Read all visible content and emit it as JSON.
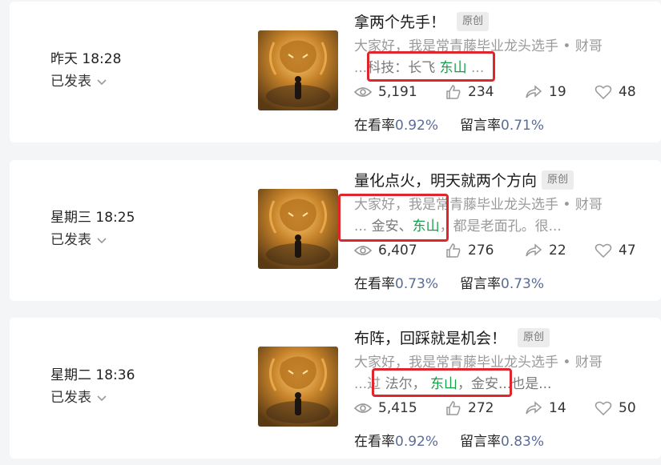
{
  "accent_colors": {
    "keyword_green": "#15a048",
    "rate_blue": "#5a6c9a",
    "highlight_red": "#e0262b"
  },
  "icons": [
    "eye-icon",
    "thumbs-up-icon",
    "share-icon",
    "heart-icon",
    "chevron-down-icon"
  ],
  "posts": [
    {
      "date": "昨天 18:28",
      "status": "已发表",
      "title": "拿两个先手！",
      "badge": "原创",
      "desc_line1": "大家好，我是常青藤毕业龙头选手 • 财哥",
      "desc_line2": {
        "pre": "...",
        "mid": "科技：长飞",
        "green": "东山",
        "post": " ..."
      },
      "views": "5,191",
      "likes": "234",
      "shares": "19",
      "favs": "48",
      "read_label": "在看率",
      "read_rate": "0.92%",
      "comment_label": "留言率",
      "comment_rate": "0.71%"
    },
    {
      "date": "星期三 18:25",
      "status": "已发表",
      "title": "量化点火，明天就两个方向",
      "badge": "原创",
      "desc_line1": "大家好，我是常青藤毕业龙头选手 • 财哥",
      "desc_line2": {
        "pre": "...",
        "mid": "金安、",
        "green": "东山",
        "post": "，都是老面孔。很..."
      },
      "views": "6,407",
      "likes": "276",
      "shares": "22",
      "favs": "47",
      "read_label": "在看率",
      "read_rate": "0.73%",
      "comment_label": "留言率",
      "comment_rate": "0.73%"
    },
    {
      "date": "星期二 18:36",
      "status": "已发表",
      "title": "布阵，回踩就是机会！",
      "badge": "原创",
      "desc_line1": "大家好，我是常青藤毕业龙头选手 • 财哥",
      "desc_line2": {
        "pre": "...过",
        "mid": "法尔，",
        "green": "东山",
        "post": "，金安...也是..."
      },
      "views": "5,415",
      "likes": "272",
      "shares": "14",
      "favs": "50",
      "read_label": "在看率",
      "read_rate": "0.92%",
      "comment_label": "留言率",
      "comment_rate": "0.83%"
    }
  ]
}
